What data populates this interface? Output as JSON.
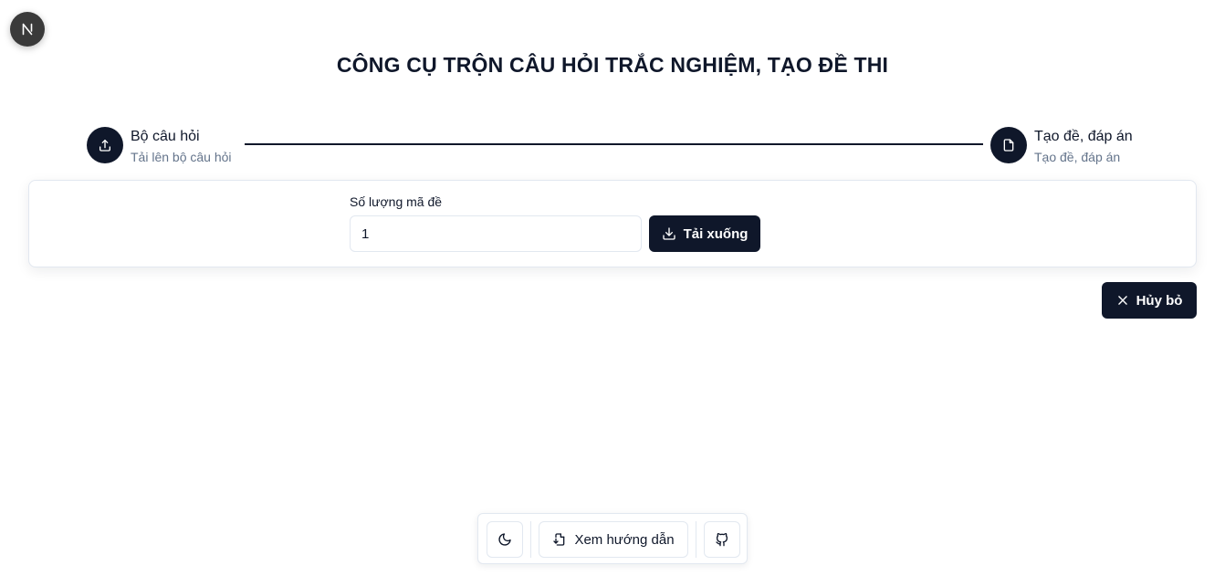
{
  "badge": {
    "letter": "N"
  },
  "header": {
    "title": "CÔNG CỤ TRỘN CÂU HỎI TRẮC NGHIỆM, TẠO ĐỀ THI"
  },
  "steps": [
    {
      "title": "Bộ câu hỏi",
      "description": "Tải lên bộ câu hỏi",
      "icon": "upload-icon"
    },
    {
      "title": "Tạo đề, đáp án",
      "description": "Tạo đề, đáp án",
      "icon": "file-icon"
    }
  ],
  "form": {
    "quantity_label": "Số lượng mã đề",
    "quantity_value": "1",
    "download_label": "Tải xuống"
  },
  "actions": {
    "cancel_label": "Hủy bỏ"
  },
  "toolbar": {
    "guide_label": "Xem hướng dẫn",
    "theme_icon": "moon-icon",
    "github_icon": "github-icon"
  },
  "colors": {
    "primary": "#0f172a",
    "muted": "#64748b",
    "border": "#e2e8f0"
  }
}
